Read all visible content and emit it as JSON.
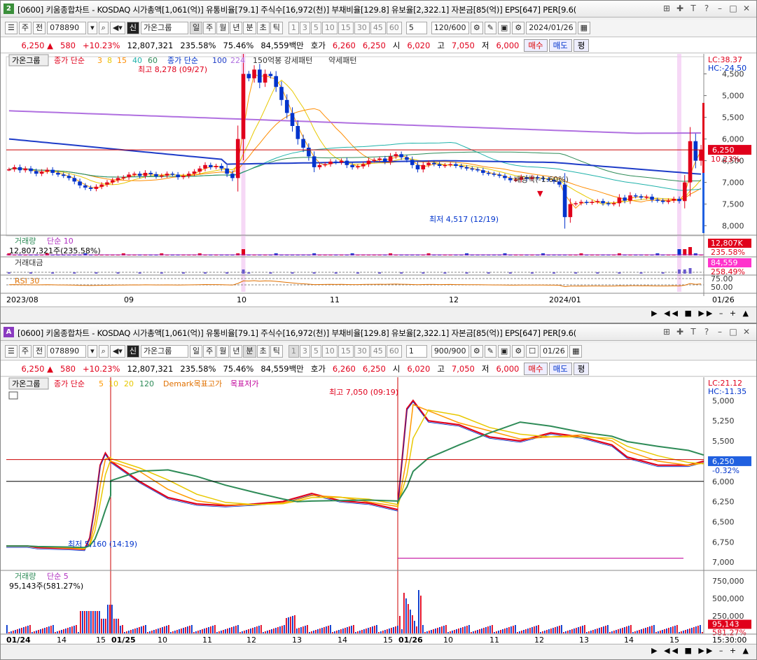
{
  "top": {
    "window_index": "2",
    "title": "[0600] 키움종합차트 - KOSDAQ 시가총액[1,061(억)] 유통비율[79.1] 주식수[16,972(천)] 부채비율[129.8] 유보율[2,322.1] 자본금[85(억)] EPS[647] PER[9.6(",
    "toolbar": {
      "type_label": "주",
      "prev_label": "전",
      "code": "078890",
      "shin_label": "신",
      "group_label": "가온그룹",
      "period_tabs": [
        "일",
        "주",
        "월",
        "년",
        "분",
        "초",
        "틱"
      ],
      "active_period": "일",
      "interval_buttons": [
        "1",
        "3",
        "5",
        "10",
        "15",
        "30",
        "45",
        "60"
      ],
      "interval_value": "5",
      "count_value": "120/600",
      "date_value": "2024/01/26"
    },
    "quote": {
      "price": "6,250",
      "arrow": "▲",
      "change": "580",
      "change_pct": "+10.23%",
      "volume": "12,807,321",
      "volume_pct": "235.58%",
      "ratio": "75.46%",
      "amount": "84,559백만",
      "hoga_label": "호가",
      "hoga1": "6,260",
      "hoga2": "6,250",
      "open_label": "시",
      "open": "6,020",
      "high_label": "고",
      "high": "7,050",
      "low_label": "저",
      "low": "6,000",
      "buy_label": "매수",
      "sell_label": "매도",
      "flat_label": "평"
    },
    "legend": {
      "group": "가온그룹",
      "ma_title": "종가 단순",
      "ma_periods": [
        "3",
        "8",
        "15",
        "40",
        "60"
      ],
      "ma2_title": "종가 단순",
      "ma2_periods": [
        "100",
        "224"
      ],
      "pattern_text": "150억봉 강세패턴",
      "weak_text": "약세패턴"
    },
    "annotations": {
      "high": "최고 8,278 (09/27)",
      "low": "최저 4,517 (12/19)",
      "ex_div": "배당락(-1.60%)"
    },
    "right_axis": {
      "lc": "LC:38.37",
      "hc": "HC:-24.50",
      "ticks": [
        "8,000",
        "7,500",
        "7,000",
        "6,500",
        "6,000",
        "5,500",
        "5,000",
        "4,500"
      ],
      "price_tag": "6,250",
      "pct_tag": "10.23%"
    },
    "volume_panel": {
      "title": "거래량",
      "ma": "단순 10",
      "value": "12,807,321주(235.58%)",
      "tag": "12,807K",
      "tag_pct": "235.58%"
    },
    "amount_panel": {
      "title": "거래대금",
      "tag": "84,559",
      "tag_pct": "258.49%"
    },
    "rsi_panel": {
      "title": "RSI 30",
      "ticks": [
        "75.00",
        "50.00"
      ]
    },
    "x_labels": [
      "2023/08",
      "09",
      "10",
      "11",
      "12",
      "2024/01",
      "01/26"
    ]
  },
  "bottom": {
    "window_index": "A",
    "title": "[0600] 키움종합차트 - KOSDAQ 시가총액[1,061(억)] 유통비율[79.1] 주식수[16,972(천)] 부채비율[129.8] 유보율[2,322.1] 자본금[85(억)] EPS[647] PER[9.6(",
    "toolbar": {
      "type_label": "주",
      "prev_label": "전",
      "code": "078890",
      "shin_label": "신",
      "group_label": "가온그룹",
      "period_tabs": [
        "일",
        "주",
        "월",
        "년",
        "분",
        "초",
        "틱"
      ],
      "active_period": "분",
      "interval_buttons": [
        "1",
        "3",
        "5",
        "10",
        "15",
        "30",
        "45",
        "60"
      ],
      "interval_value": "1",
      "count_value": "900/900",
      "date_value": "01/26"
    },
    "quote": {
      "price": "6,250",
      "arrow": "▲",
      "change": "580",
      "change_pct": "+10.23%",
      "volume": "12,807,321",
      "volume_pct": "235.58%",
      "ratio": "75.46%",
      "amount": "84,559백만",
      "hoga_label": "호가",
      "hoga1": "6,260",
      "hoga2": "6,250",
      "open_label": "시",
      "open": "6,020",
      "high_label": "고",
      "high": "7,050",
      "low_label": "저",
      "low": "6,000",
      "buy_label": "매수",
      "sell_label": "매도",
      "flat_label": "평"
    },
    "legend": {
      "group": "가온그룹",
      "ma_title": "종가 단순",
      "ma_periods": [
        "5",
        "10",
        "20",
        "120"
      ],
      "demark": "Demark목표고가",
      "demark_low": "목표저가"
    },
    "annotations": {
      "high": "최고 7,050 (09:19)",
      "low": "최저 5,160 (14:19)"
    },
    "right_axis": {
      "lc": "LC:21.12",
      "hc": "HC:-11.35",
      "ticks": [
        "7,000",
        "6,750",
        "6,500",
        "6,250",
        "6,000",
        "5,750",
        "5,500",
        "5,250",
        "5,000"
      ],
      "price_tag": "6,250",
      "pct_tag": "-0.32%"
    },
    "volume_panel": {
      "title": "거래량",
      "ma": "단순 5",
      "value": "95,143주(581.27%)",
      "ticks": [
        "750,000",
        "500,000",
        "250,000"
      ],
      "tag": "95,143",
      "tag_pct": "581.27%"
    },
    "x_labels": [
      "01/24",
      "14",
      "15",
      "01/25",
      "10",
      "11",
      "12",
      "13",
      "14",
      "15",
      "01/26",
      "10",
      "11",
      "12",
      "13",
      "14",
      "15",
      "15:30:00"
    ]
  },
  "colors": {
    "up": "#e0001b",
    "down": "#0033cc",
    "ma_orange": "#ff9900",
    "ma_yellow": "#e8c800",
    "ma_green": "#2e8b57",
    "ma_teal": "#20b2aa",
    "ma_purple": "#b070e0",
    "ma_navy": "#1e3cc8",
    "spike": "#f2c8f2"
  },
  "chart_data": [
    {
      "type": "candlestick",
      "title": "가온그룹 일봉",
      "ylim": [
        4300,
        8300
      ],
      "y_ticks": [
        4500,
        5000,
        5500,
        6000,
        6500,
        7000,
        7500,
        8000
      ],
      "x_axis_labels": [
        "2023/08",
        "09",
        "10",
        "11",
        "12",
        "2024/01",
        "01/26"
      ],
      "closes": [
        5800,
        5850,
        5780,
        5820,
        5760,
        5700,
        5750,
        5790,
        5720,
        5680,
        5650,
        5600,
        5520,
        5430,
        5380,
        5350,
        5400,
        5450,
        5500,
        5550,
        5600,
        5620,
        5680,
        5700,
        5650,
        5720,
        5690,
        5640,
        5660,
        5700,
        5680,
        5620,
        5650,
        5700,
        5750,
        5820,
        5900,
        5850,
        5880,
        5820,
        5700,
        5600,
        6500,
        8000,
        7900,
        8100,
        7800,
        8000,
        7950,
        7700,
        7400,
        7100,
        6800,
        6500,
        6300,
        6100,
        5850,
        5900,
        5920,
        5980,
        5960,
        6000,
        5900,
        5850,
        5870,
        5920,
        6000,
        6020,
        6050,
        5980,
        6100,
        6150,
        6080,
        6020,
        5900,
        5800,
        5900,
        5950,
        5920,
        5880,
        5900,
        5920,
        5880,
        5850,
        5820,
        5800,
        5780,
        5720,
        5700,
        5680,
        5650,
        5600,
        5550,
        5560,
        5620,
        5580,
        5620,
        5600,
        5580,
        5560,
        5520,
        5450,
        4700,
        5000,
        5020,
        5050,
        5030,
        5050,
        5070,
        5020,
        5000,
        5020,
        5150,
        5080,
        5200,
        5180,
        5150,
        5170,
        5100,
        5080,
        5050,
        5080,
        5120,
        5070,
        5500,
        6450,
        6000,
        6250
      ],
      "ma_series": [
        {
          "name": "MA3",
          "color": "#ff9900"
        },
        {
          "name": "MA8",
          "color": "#e8c800"
        },
        {
          "name": "MA15",
          "color": "#ff8c00"
        },
        {
          "name": "MA40",
          "color": "#20b2aa"
        },
        {
          "name": "MA60",
          "color": "#2e8b57"
        },
        {
          "name": "MA100",
          "color": "#1e3cc8"
        },
        {
          "name": "MA224",
          "color": "#b070e0"
        }
      ],
      "volume_spikes_index": [
        43,
        123,
        124,
        125
      ],
      "hline_value": 6250
    },
    {
      "type": "line",
      "title": "가온그룹 1분봉",
      "ylim": [
        4950,
        7150
      ],
      "y_ticks": [
        5000,
        5250,
        5500,
        5750,
        6000,
        6250,
        6500,
        6750,
        7000
      ],
      "x_axis_labels": [
        "01/24",
        "14",
        "15",
        "01/25",
        "10",
        "11",
        "12",
        "13",
        "14",
        "15",
        "01/26",
        "10",
        "11",
        "12",
        "13",
        "14",
        "15",
        "15:30:00"
      ],
      "segments": [
        {
          "day": "01/24",
          "points": [
            [
              0,
              5200
            ],
            [
              0.2,
              5200
            ],
            [
              0.3,
              5180
            ],
            [
              0.6,
              5170
            ],
            [
              0.75,
              5160
            ],
            [
              0.8,
              5300
            ],
            [
              0.85,
              5700
            ],
            [
              0.9,
              6200
            ],
            [
              0.95,
              6350
            ],
            [
              1.0,
              6250
            ]
          ]
        },
        {
          "day": "01/25",
          "points": [
            [
              0,
              6250
            ],
            [
              0.1,
              6000
            ],
            [
              0.2,
              5800
            ],
            [
              0.3,
              5720
            ],
            [
              0.4,
              5700
            ],
            [
              0.5,
              5720
            ],
            [
              0.6,
              5750
            ],
            [
              0.65,
              5800
            ],
            [
              0.7,
              5850
            ],
            [
              0.8,
              5760
            ],
            [
              0.9,
              5730
            ],
            [
              1.0,
              5650
            ]
          ]
        },
        {
          "day": "01/26",
          "points": [
            [
              0,
              5700
            ],
            [
              0.03,
              6900
            ],
            [
              0.05,
              7000
            ],
            [
              0.1,
              6750
            ],
            [
              0.2,
              6700
            ],
            [
              0.3,
              6550
            ],
            [
              0.4,
              6500
            ],
            [
              0.5,
              6600
            ],
            [
              0.6,
              6550
            ],
            [
              0.7,
              6450
            ],
            [
              0.75,
              6300
            ],
            [
              0.85,
              6200
            ],
            [
              0.95,
              6200
            ],
            [
              1.0,
              6250
            ]
          ]
        }
      ],
      "hlines": [
        6270,
        6000
      ],
      "target_low": 5050
    }
  ]
}
